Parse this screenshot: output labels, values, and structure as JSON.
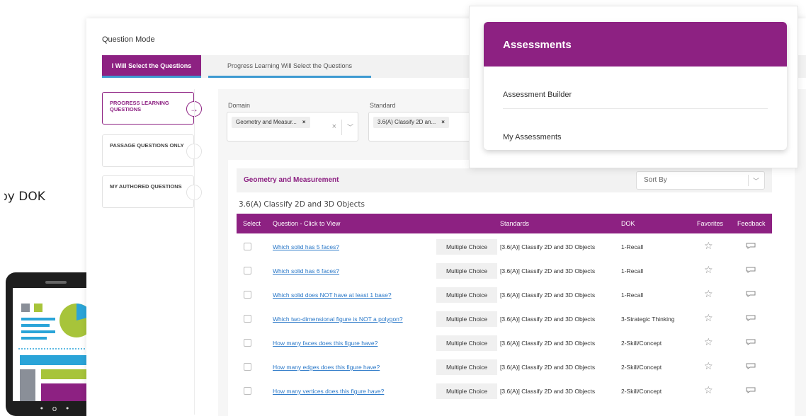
{
  "side_text": "by DOK",
  "question_mode": {
    "title": "Question Mode",
    "tab_active": "I Will Select the Questions",
    "tab_inactive": "Progress Learning Will Select the Questions"
  },
  "sources": [
    {
      "label": "PROGRESS LEARNING QUESTIONS",
      "active": true
    },
    {
      "label": "PASSAGE QUESTIONS ONLY",
      "active": false
    },
    {
      "label": "MY AUTHORED QUESTIONS",
      "active": false
    }
  ],
  "filters": {
    "domain_label": "Domain",
    "domain_chip": "Geometry and Measur...",
    "standard_label": "Standard",
    "standard_chip": "3.6(A) Classify 2D an...",
    "chip_remove": "×",
    "clear": "×"
  },
  "results": {
    "title": "Geometry and Measurement",
    "sort_by": "Sort By",
    "standard_heading": "3.6(A) Classify 2D and 3D Objects",
    "columns": {
      "select": "Select",
      "question": "Question - Click to View",
      "standards": "Standards",
      "dok": "DOK",
      "favorites": "Favorites",
      "feedback": "Feedback"
    },
    "rows": [
      {
        "question": "Which solid has 5 faces?",
        "type": "Multiple Choice",
        "standard": "[3.6(A)] Classify 2D and 3D Objects",
        "dok": "1-Recall"
      },
      {
        "question": "Which solid has 6 faces?",
        "type": "Multiple Choice",
        "standard": "[3.6(A)] Classify 2D and 3D Objects",
        "dok": "1-Recall"
      },
      {
        "question": "Which solid does NOT have at least 1 base?",
        "type": "Multiple Choice",
        "standard": "[3.6(A)] Classify 2D and 3D Objects",
        "dok": "1-Recall"
      },
      {
        "question": "Which two-dimensional figure is NOT a polygon?",
        "type": "Multiple Choice",
        "standard": "[3.6(A)] Classify 2D and 3D Objects",
        "dok": "3-Strategic Thinking"
      },
      {
        "question": "How many faces does this figure have?",
        "type": "Multiple Choice",
        "standard": "[3.6(A)] Classify 2D and 3D Objects",
        "dok": "2-Skill/Concept"
      },
      {
        "question": "How many edges does this figure have?",
        "type": "Multiple Choice",
        "standard": "[3.6(A)] Classify 2D and 3D Objects",
        "dok": "2-Skill/Concept"
      },
      {
        "question": "How many vertices does this figure have?",
        "type": "Multiple Choice",
        "standard": "[3.6(A)] Classify 2D and 3D Objects",
        "dok": "2-Skill/Concept"
      }
    ]
  },
  "assessments_menu": {
    "title": "Assessments",
    "items": [
      "Assessment Builder",
      "My Assessments"
    ]
  },
  "colors": {
    "brand_purple": "#8d2182",
    "link_blue": "#2a78c8",
    "tab_underline": "#3d9ad1"
  }
}
